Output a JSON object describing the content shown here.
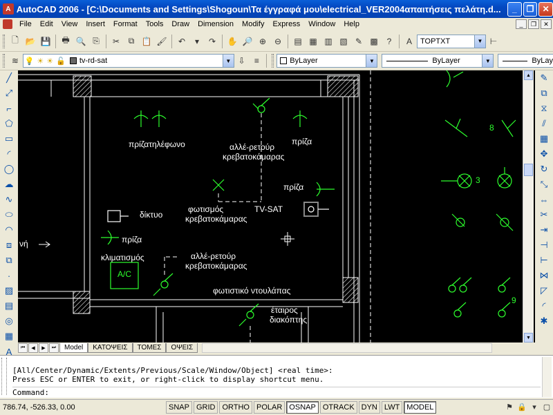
{
  "window": {
    "title": "AutoCAD 2006 - [C:\\Documents and Settings\\Shogoun\\Τα έγγραφά μου\\electrical_VER2004απαιτήσεις πελάτη.d...",
    "minimize": "_",
    "restore": "❐",
    "close": "✕"
  },
  "menu": {
    "items": [
      "File",
      "Edit",
      "View",
      "Insert",
      "Format",
      "Tools",
      "Draw",
      "Dimension",
      "Modify",
      "Express",
      "Window",
      "Help"
    ]
  },
  "toolbar1": {
    "text_style": "TOPTXT"
  },
  "toolbar2": {
    "layer": "tv-rd-sat",
    "color": "ByLayer",
    "linetype": "ByLayer",
    "lineweight": "ByLay"
  },
  "drawing": {
    "labels": {
      "phone_socket": "πρίζατηλέφωνο",
      "two_way_1": "αλλέ-ρετούρ",
      "bedroom_1": "κρεβατοκάμαρας",
      "socket_1": "πρίζα",
      "socket_2": "πρίζα",
      "lighting": "φωτισμός",
      "bedroom_2": "κρεβατοκάμαρας",
      "tv_sat": "TV-SAT",
      "network": "δίκτυο",
      "socket_3": "πρίζα",
      "fragment": "νή",
      "aircon": "κλιματισμός",
      "ac": "A/C",
      "two_way_2": "αλλέ-ρετούρ",
      "bedroom_3": "κρεβατοκάμαρας",
      "closet_light": "φωτιστικό ντουλάπας",
      "switch_1": "έταιρος",
      "switch_2": "διακόπτης",
      "num_8": "8",
      "num_3": "3",
      "num_9": "9"
    }
  },
  "tabs": {
    "items": [
      "Model",
      "ΚΑΤΟΨΕΙΣ",
      "ΤΟΜΕΣ",
      "ΟΨΕΙΣ"
    ]
  },
  "command": {
    "line1": "[All/Center/Dynamic/Extents/Previous/Scale/Window/Object] <real time>:",
    "line2": "Press ESC or ENTER to exit, or right-click to display shortcut menu.",
    "prompt": "Command:"
  },
  "status": {
    "coords": "786.74, -526.33, 0.00",
    "buttons": [
      {
        "label": "SNAP",
        "on": false
      },
      {
        "label": "GRID",
        "on": false
      },
      {
        "label": "ORTHO",
        "on": false
      },
      {
        "label": "POLAR",
        "on": false
      },
      {
        "label": "OSNAP",
        "on": true
      },
      {
        "label": "OTRACK",
        "on": false
      },
      {
        "label": "DYN",
        "on": false
      },
      {
        "label": "LWT",
        "on": false
      },
      {
        "label": "MODEL",
        "on": true
      }
    ]
  },
  "colors": {
    "cad_background": "#000000",
    "cad_green": "#2dff2d",
    "cad_white": "#ffffff",
    "titlebar": "#0348c0"
  }
}
